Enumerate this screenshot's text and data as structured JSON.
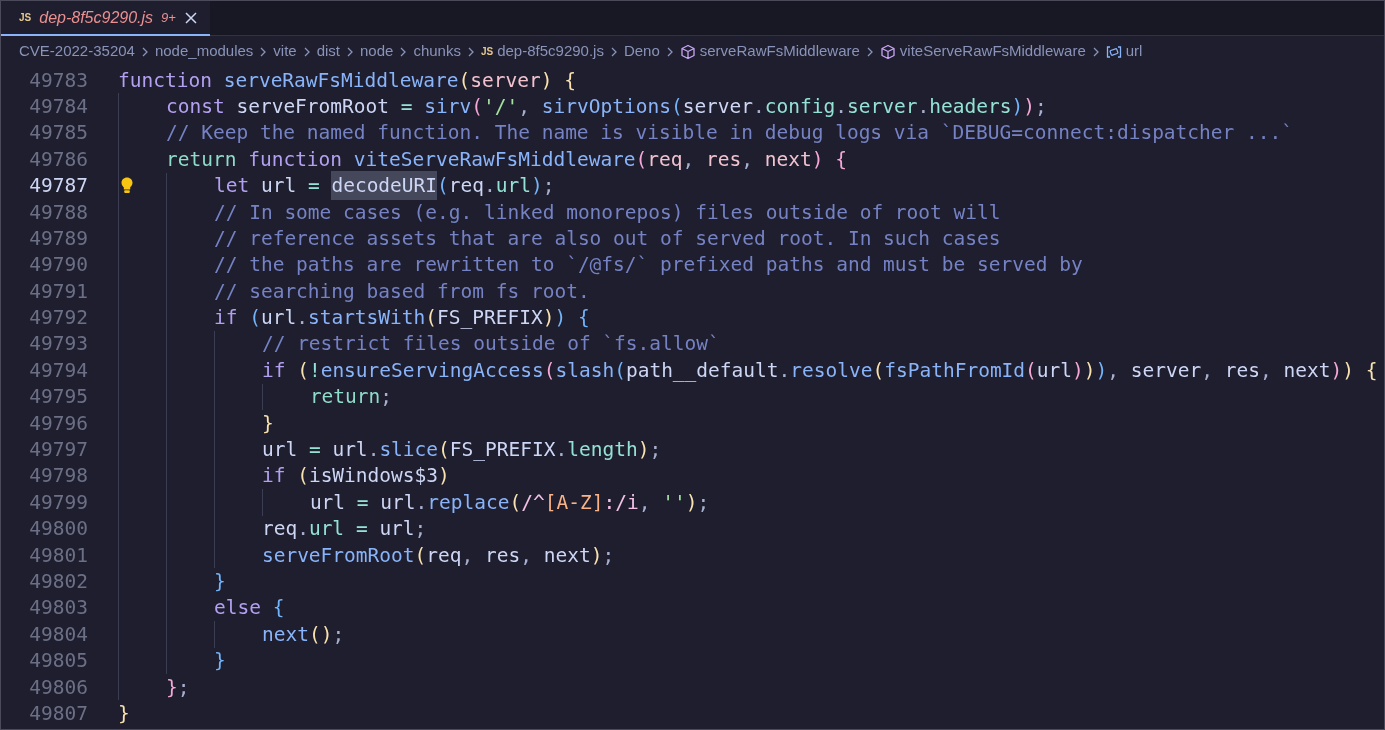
{
  "tab": {
    "icon_text": "JS",
    "label": "dep-8f5c9290.js",
    "badge": "9+",
    "selected": true
  },
  "breadcrumb": [
    {
      "kind": "folder",
      "label": "CVE-2022-35204"
    },
    {
      "kind": "folder",
      "label": "node_modules"
    },
    {
      "kind": "folder",
      "label": "vite"
    },
    {
      "kind": "folder",
      "label": "dist"
    },
    {
      "kind": "folder",
      "label": "node"
    },
    {
      "kind": "folder",
      "label": "chunks"
    },
    {
      "kind": "file",
      "icon_text": "JS",
      "label": "dep-8f5c9290.js"
    },
    {
      "kind": "folder",
      "label": "Deno"
    },
    {
      "kind": "symbol",
      "label": "serveRawFsMiddleware"
    },
    {
      "kind": "symbol",
      "label": "viteServeRawFsMiddleware"
    },
    {
      "kind": "variable",
      "label": "url"
    }
  ],
  "lines": [
    {
      "number": "49783",
      "current": false,
      "lightbulb": false,
      "segments": [
        {
          "text": "function serveRawFsMiddleware(server) {",
          "highlighted": false
        }
      ]
    },
    {
      "number": "49784",
      "current": false,
      "lightbulb": false,
      "segments": [
        {
          "text": "    const serveFromRoot = sirv('/', sirvOptions(server.config.server.headers));",
          "highlighted": false
        }
      ]
    },
    {
      "number": "49785",
      "current": false,
      "lightbulb": false,
      "segments": [
        {
          "text": "    // Keep the named function. The name is visible in debug logs via `DEBUG=connect:dispatcher ...`",
          "highlighted": false
        }
      ]
    },
    {
      "number": "49786",
      "current": false,
      "lightbulb": false,
      "segments": [
        {
          "text": "    return function viteServeRawFsMiddleware(req, res, next) {",
          "highlighted": false
        }
      ]
    },
    {
      "number": "49787",
      "current": true,
      "lightbulb": true,
      "segments": [
        {
          "text": "        let url = ",
          "highlighted": false
        },
        {
          "text": "decodeURI",
          "highlighted": true
        },
        {
          "text": "(req.url);",
          "highlighted": false
        }
      ]
    },
    {
      "number": "49788",
      "current": false,
      "lightbulb": false,
      "segments": [
        {
          "text": "        // In some cases (e.g. linked monorepos) files outside of root will",
          "highlighted": false
        }
      ]
    },
    {
      "number": "49789",
      "current": false,
      "lightbulb": false,
      "segments": [
        {
          "text": "        // reference assets that are also out of served root. In such cases",
          "highlighted": false
        }
      ]
    },
    {
      "number": "49790",
      "current": false,
      "lightbulb": false,
      "segments": [
        {
          "text": "        // the paths are rewritten to `/@fs/` prefixed paths and must be served by",
          "highlighted": false
        }
      ]
    },
    {
      "number": "49791",
      "current": false,
      "lightbulb": false,
      "segments": [
        {
          "text": "        // searching based from fs root.",
          "highlighted": false
        }
      ]
    },
    {
      "number": "49792",
      "current": false,
      "lightbulb": false,
      "segments": [
        {
          "text": "        if (url.startsWith(FS_PREFIX)) {",
          "highlighted": false
        }
      ]
    },
    {
      "number": "49793",
      "current": false,
      "lightbulb": false,
      "segments": [
        {
          "text": "            // restrict files outside of `fs.allow`",
          "highlighted": false
        }
      ]
    },
    {
      "number": "49794",
      "current": false,
      "lightbulb": false,
      "segments": [
        {
          "text": "            if (!ensureServingAccess(slash(path__default.resolve(fsPathFromId(url))), server, res, next)) {",
          "highlighted": false
        }
      ]
    },
    {
      "number": "49795",
      "current": false,
      "lightbulb": false,
      "segments": [
        {
          "text": "                return;",
          "highlighted": false
        }
      ]
    },
    {
      "number": "49796",
      "current": false,
      "lightbulb": false,
      "segments": [
        {
          "text": "            }",
          "highlighted": false
        }
      ]
    },
    {
      "number": "49797",
      "current": false,
      "lightbulb": false,
      "segments": [
        {
          "text": "            url = url.slice(FS_PREFIX.length);",
          "highlighted": false
        }
      ]
    },
    {
      "number": "49798",
      "current": false,
      "lightbulb": false,
      "segments": [
        {
          "text": "            if (isWindows$3)",
          "highlighted": false
        }
      ]
    },
    {
      "number": "49799",
      "current": false,
      "lightbulb": false,
      "segments": [
        {
          "text": "                url = url.replace(/^[A-Z]:/i, '');",
          "highlighted": false
        }
      ]
    },
    {
      "number": "49800",
      "current": false,
      "lightbulb": false,
      "segments": [
        {
          "text": "            req.url = url;",
          "highlighted": false
        }
      ]
    },
    {
      "number": "49801",
      "current": false,
      "lightbulb": false,
      "segments": [
        {
          "text": "            serveFromRoot(req, res, next);",
          "highlighted": false
        }
      ]
    },
    {
      "number": "49802",
      "current": false,
      "lightbulb": false,
      "segments": [
        {
          "text": "        }",
          "highlighted": false
        }
      ]
    },
    {
      "number": "49803",
      "current": false,
      "lightbulb": false,
      "segments": [
        {
          "text": "        else {",
          "highlighted": false
        }
      ]
    },
    {
      "number": "49804",
      "current": false,
      "lightbulb": false,
      "segments": [
        {
          "text": "            next();",
          "highlighted": false
        }
      ]
    },
    {
      "number": "49805",
      "current": false,
      "lightbulb": false,
      "segments": [
        {
          "text": "        }",
          "highlighted": false
        }
      ]
    },
    {
      "number": "49806",
      "current": false,
      "lightbulb": false,
      "segments": [
        {
          "text": "    };",
          "highlighted": false
        }
      ]
    },
    {
      "number": "49807",
      "current": false,
      "lightbulb": false,
      "segments": [
        {
          "text": "}",
          "highlighted": false
        }
      ]
    }
  ]
}
